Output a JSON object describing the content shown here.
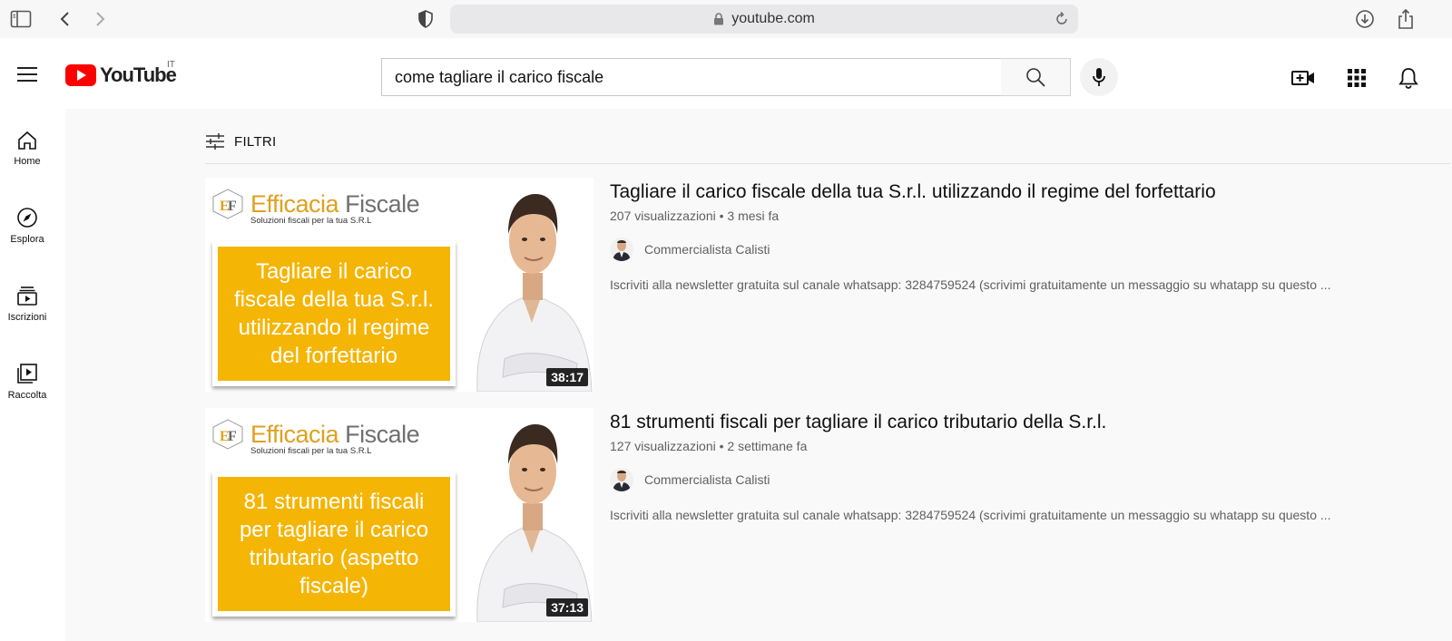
{
  "browser": {
    "url": "youtube.com"
  },
  "header": {
    "logo_text": "YouTube",
    "region": "IT",
    "search_value": "come tagliare il carico fiscale"
  },
  "sidebar": {
    "items": [
      {
        "label": "Home",
        "icon": "home-icon"
      },
      {
        "label": "Esplora",
        "icon": "compass-icon"
      },
      {
        "label": "Iscrizioni",
        "icon": "subscriptions-icon"
      },
      {
        "label": "Raccolta",
        "icon": "library-icon"
      }
    ]
  },
  "filters": {
    "label": "FILTRI"
  },
  "results": [
    {
      "title": "Tagliare il carico fiscale della tua S.r.l. utilizzando il regime del forfettario",
      "views": "207 visualizzazioni",
      "age": "3 mesi fa",
      "channel": "Commercialista Calisti",
      "description": "Iscriviti alla newsletter gratuita sul canale whatsapp: 3284759524 (scrivimi gratuitamente un messaggio su whatapp su questo ...",
      "duration": "38:17",
      "thumb_brand_a": "Efficacia",
      "thumb_brand_b": "Fiscale",
      "thumb_sub": "Soluzioni fiscali per la tua S.R.L",
      "thumb_text": "Tagliare il carico fiscale della tua S.r.l. utilizzando il regime del forfettario"
    },
    {
      "title": "81 strumenti fiscali per tagliare il carico tributario della S.r.l.",
      "views": "127 visualizzazioni",
      "age": "2 settimane fa",
      "channel": "Commercialista Calisti",
      "description": "Iscriviti alla newsletter gratuita sul canale whatsapp: 3284759524 (scrivimi gratuitamente un messaggio su whatapp su questo ...",
      "duration": "37:13",
      "thumb_brand_a": "Efficacia",
      "thumb_brand_b": "Fiscale",
      "thumb_sub": "Soluzioni fiscali per la tua S.R.L",
      "thumb_text": "81 strumenti fiscali per tagliare il carico tributario (aspetto fiscale)"
    }
  ],
  "colors": {
    "yt_red": "#ff0000",
    "thumb_yellow": "#f5b505",
    "brand_gold": "#e0a020"
  }
}
